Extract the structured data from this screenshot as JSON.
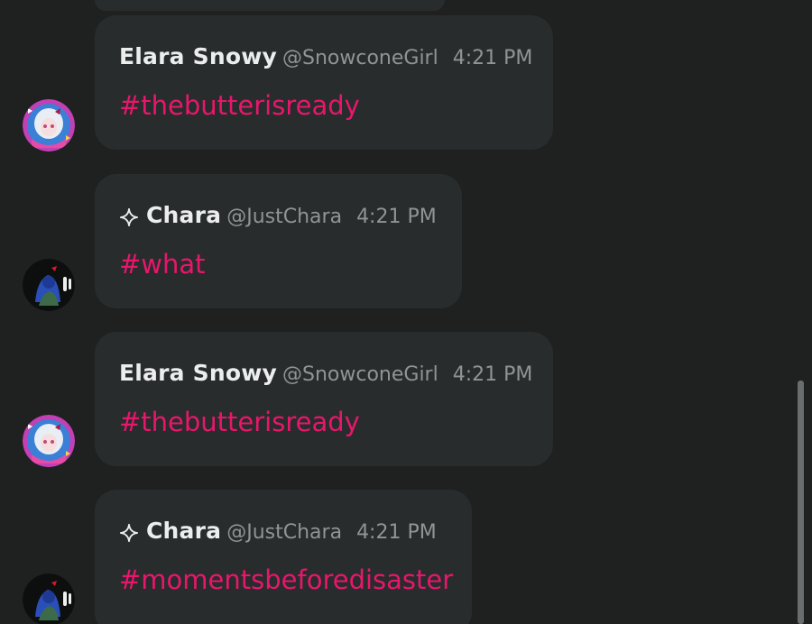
{
  "messages": [
    {
      "author": "Elara Snowy",
      "handle": "@SnowconeGirl",
      "time": "4:21 PM",
      "text": "#thebutterisready",
      "verified": false,
      "avatar": "elara-avatar"
    },
    {
      "author": "Chara",
      "handle": "@JustChara",
      "time": "4:21 PM",
      "text": "#what",
      "verified": true,
      "avatar": "chara-avatar"
    },
    {
      "author": "Elara Snowy",
      "handle": "@SnowconeGirl",
      "time": "4:21 PM",
      "text": "#thebutterisready",
      "verified": false,
      "avatar": "elara-avatar"
    },
    {
      "author": "Chara",
      "handle": "@JustChara",
      "time": "4:21 PM",
      "text": "#momentsbeforedisaster",
      "verified": true,
      "avatar": "chara-avatar"
    }
  ],
  "icons": {
    "verified_badge": "sparkle-icon"
  },
  "colors": {
    "background": "#1f2121",
    "bubble": "#292c2c",
    "hashtag": "#e8166c",
    "author": "#eceeee",
    "muted": "#8f9494",
    "scrollbar": "#6a6d6d"
  }
}
